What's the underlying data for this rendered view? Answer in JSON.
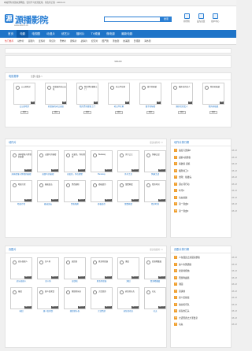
{
  "topbar": {
    "text": "本站所有资源来源网络，仅供学习交流使用，请支持正版 · Admin.cn"
  },
  "header": {
    "logo_glyph": "源",
    "logo_text": "源播影院",
    "logo_url": "www.admin.cn",
    "search_button": "搜索",
    "icons": [
      {
        "name": "chart-icon",
        "label": "排行榜"
      },
      {
        "name": "home-icon",
        "label": "设为首页"
      },
      {
        "name": "user-icon",
        "label": "用户中心"
      }
    ]
  },
  "nav": [
    {
      "label": "首页",
      "active": false
    },
    {
      "label": "电影",
      "active": true
    },
    {
      "label": "电视剧",
      "active": false
    },
    {
      "label": "动漫片",
      "active": false
    },
    {
      "label": "综艺片",
      "active": false
    },
    {
      "label": "福利片",
      "active": false
    },
    {
      "label": "TV频道",
      "active": false
    },
    {
      "label": "微电影",
      "active": false
    },
    {
      "label": "最新电影",
      "active": false
    }
  ],
  "subnav": [
    {
      "label": "热门推荐",
      "highlight": true
    },
    {
      "label": "动作片"
    },
    {
      "label": "喜剧片"
    },
    {
      "label": "爱情片"
    },
    {
      "label": "科幻片"
    },
    {
      "label": "恐怖片"
    },
    {
      "label": "剧情片"
    },
    {
      "label": "战争片"
    },
    {
      "label": "纪录片"
    },
    {
      "label": "国产剧"
    },
    {
      "label": "港台剧"
    },
    {
      "label": "欧美剧"
    },
    {
      "label": "日韩剧"
    },
    {
      "label": "海外剧"
    }
  ],
  "ad": {
    "label": "960x60"
  },
  "section1": {
    "title": "电影推荐",
    "filter": "全部 | 更多 >",
    "items": [
      {
        "title": "公公的暗示",
        "caption": "公公的暗示",
        "tag": "HD"
      },
      {
        "title": "好姐妹的老公出轨",
        "caption": "好姐妹的老公出轨",
        "tag": "HD"
      },
      {
        "title": "我的漂亮婆婆上门",
        "caption": "我的漂亮婆婆上门",
        "tag": "HD"
      },
      {
        "title": "老公不在家",
        "caption": "老公不在家",
        "tag": "HD"
      },
      {
        "title": "嫂子的秘密",
        "caption": "嫂子的秘密",
        "tag": "HD"
      },
      {
        "title": "婚外恋的女人",
        "caption": "婚外恋的女人",
        "tag": "HD"
      },
      {
        "title": "我的老板娘",
        "caption": "我的老板娘",
        "tag": "HD"
      }
    ],
    "button": "播放"
  },
  "section2": {
    "title": "动作片",
    "more": "更多动作片 >>",
    "items": [
      {
        "title": "天神部落与梦想的秘密",
        "caption": "天神部落与梦想的秘密"
      },
      {
        "title": "无脚鸟的秘密",
        "caption": "无脚鸟的秘密"
      },
      {
        "title": "亲爱的，你在哪里",
        "caption": "亲爱的，你在哪里"
      },
      {
        "title": "Bestway",
        "caption": "Bestway"
      },
      {
        "title": "杀手之王",
        "caption": "杀手之王"
      },
      {
        "title": "风暴之战",
        "caption": "风暴之战"
      },
      {
        "title": "暗夜行者",
        "caption": "暗夜行者"
      },
      {
        "title": "极速追击",
        "caption": "极速追击"
      },
      {
        "title": "黑色陷阱",
        "caption": "黑色陷阱"
      },
      {
        "title": "终极使命",
        "caption": "终极使命"
      },
      {
        "title": "雷霆救援",
        "caption": "雷霆救援"
      },
      {
        "title": "猎杀时刻",
        "caption": "猎杀时刻"
      }
    ],
    "tag": "HD中字"
  },
  "rank1": {
    "title": "动作片排行榜",
    "items": [
      {
        "n": "1",
        "t": "速度与激情8",
        "d": "08-18"
      },
      {
        "n": "2",
        "t": "战狼2完整版",
        "d": "08-18"
      },
      {
        "n": "3",
        "t": "杀破狼·贪狼",
        "d": "08-18"
      },
      {
        "n": "4",
        "t": "极限特工3",
        "d": "08-18"
      },
      {
        "n": "5",
        "t": "金刚：骷髅岛",
        "d": "08-18"
      },
      {
        "n": "6",
        "t": "湄公河行动",
        "d": "08-18"
      },
      {
        "n": "7",
        "t": "叶问3",
        "d": "08-18"
      },
      {
        "n": "8",
        "t": "功夫瑜伽",
        "d": "08-18"
      },
      {
        "n": "9",
        "t": "第一滴血2",
        "d": "08-18"
      },
      {
        "n": "10",
        "t": "第一滴血3",
        "d": "08-18"
      }
    ]
  },
  "section3": {
    "title": "喜剧片",
    "more": "更多喜剧片 >>",
    "items": [
      {
        "title": "欢乐喜剧人",
        "caption": "欢乐喜剧人"
      },
      {
        "title": "美人鱼",
        "caption": "美人鱼"
      },
      {
        "title": "煎饼侠",
        "caption": "煎饼侠"
      },
      {
        "title": "夏洛特烦恼",
        "caption": "夏洛特烦恼"
      },
      {
        "title": "港囧",
        "caption": "港囧"
      },
      {
        "title": "西游降魔篇",
        "caption": "西游降魔篇"
      },
      {
        "title": "泰囧",
        "caption": "泰囧"
      },
      {
        "title": "唐人街探案",
        "caption": "唐人街探案"
      },
      {
        "title": "缝纫机乐队",
        "caption": "缝纫机乐队"
      },
      {
        "title": "大话西游",
        "caption": "大话西游"
      },
      {
        "title": "疯狂的石头",
        "caption": "疯狂的石头"
      },
      {
        "title": "功夫",
        "caption": "功夫"
      }
    ],
    "tag": "HD中字"
  },
  "rank2": {
    "title": "喜剧片排行榜",
    "items": [
      {
        "n": "1",
        "t": "人在囧途之泰囧完整版",
        "d": "08-18"
      },
      {
        "n": "2",
        "t": "美人鱼国语版",
        "d": "08-18"
      },
      {
        "n": "3",
        "t": "夏洛特烦恼",
        "d": "08-18"
      },
      {
        "n": "4",
        "t": "西游降魔篇",
        "d": "08-18"
      },
      {
        "n": "5",
        "t": "港囧",
        "d": "08-18"
      },
      {
        "n": "6",
        "t": "煎饼侠",
        "d": "08-18"
      },
      {
        "n": "7",
        "t": "唐人街探案",
        "d": "08-18"
      },
      {
        "n": "8",
        "t": "缝纫机乐队",
        "d": "08-18"
      },
      {
        "n": "9",
        "t": "疯狂的石头",
        "d": "08-18"
      },
      {
        "n": "10",
        "t": "大话西游之大圣娶亲",
        "d": "08-18"
      },
      {
        "n": "11",
        "t": "功夫",
        "d": "08-18"
      }
    ]
  }
}
